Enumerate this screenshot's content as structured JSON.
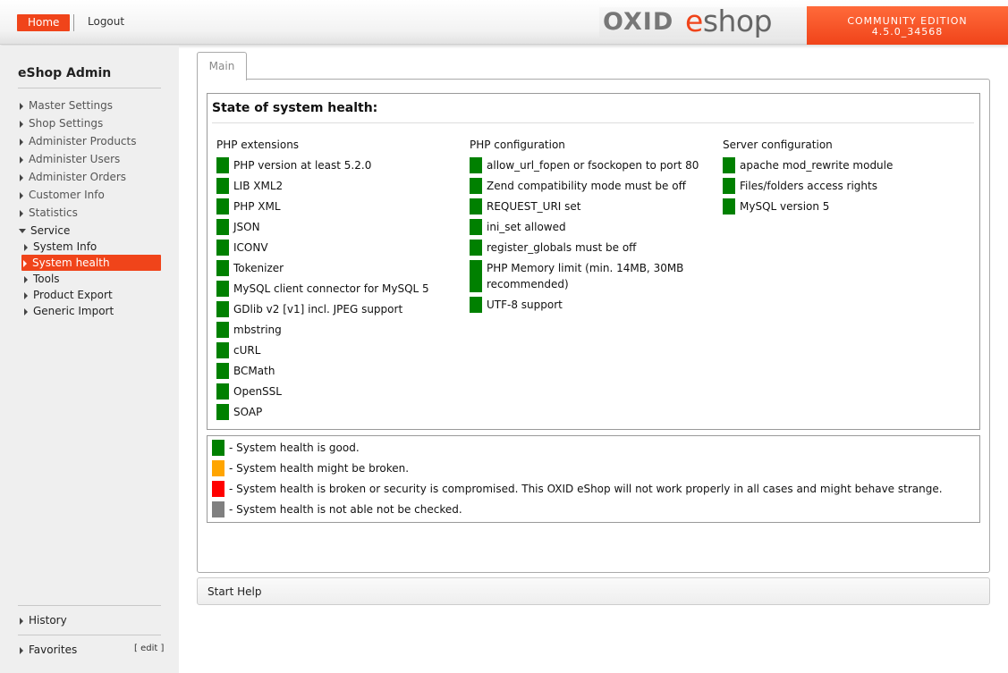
{
  "header": {
    "home_label": "Home",
    "logout_label": "Logout",
    "logo_oxid": "OXID",
    "logo_e": "e",
    "logo_shop": "shop",
    "edition": "COMMUNITY EDITION",
    "version": "4.5.0_34568",
    "accent_color": "#f0441a"
  },
  "sidebar": {
    "title": "eShop Admin",
    "items": [
      {
        "label": "Master Settings"
      },
      {
        "label": "Shop Settings"
      },
      {
        "label": "Administer Products"
      },
      {
        "label": "Administer Users"
      },
      {
        "label": "Administer Orders"
      },
      {
        "label": "Customer Info"
      },
      {
        "label": "Statistics"
      },
      {
        "label": "Service"
      }
    ],
    "service_sub": [
      {
        "label": "System Info"
      },
      {
        "label": "System health"
      },
      {
        "label": "Tools"
      },
      {
        "label": "Product Export"
      },
      {
        "label": "Generic Import"
      }
    ],
    "history_label": "History",
    "favorites_label": "Favorites",
    "favorites_edit": "[ edit ]"
  },
  "main": {
    "tab_label": "Main",
    "heading": "State of system health:",
    "columns": [
      {
        "title": "PHP extensions",
        "rows": [
          "PHP version at least 5.2.0",
          "LIB XML2",
          "PHP XML",
          "JSON",
          "ICONV",
          "Tokenizer",
          "MySQL client connector for MySQL 5",
          "GDlib v2 [v1] incl. JPEG support",
          "mbstring",
          "cURL",
          "BCMath",
          "OpenSSL",
          "SOAP"
        ]
      },
      {
        "title": "PHP configuration",
        "rows": [
          "allow_url_fopen or fsockopen to port 80",
          "Zend compatibility mode must be off",
          "REQUEST_URI set",
          "ini_set allowed",
          "register_globals must be off",
          "PHP Memory limit (min. 14MB, 30MB recommended)",
          "UTF-8 support"
        ]
      },
      {
        "title": "Server configuration",
        "rows": [
          "apache mod_rewrite module",
          "Files/folders access rights",
          "MySQL version 5"
        ]
      }
    ],
    "status_color_good": "#008000",
    "legend": [
      {
        "color": "#008000",
        "text": "- System health is good."
      },
      {
        "color": "#ffa500",
        "text": "- System health might be broken."
      },
      {
        "color": "#ff0000",
        "text": "- System health is broken or security is compromised. This OXID eShop will not work properly in all cases and might behave strange."
      },
      {
        "color": "#808080",
        "text": "- System health is not able not be checked."
      }
    ],
    "help_label": "Start Help"
  }
}
